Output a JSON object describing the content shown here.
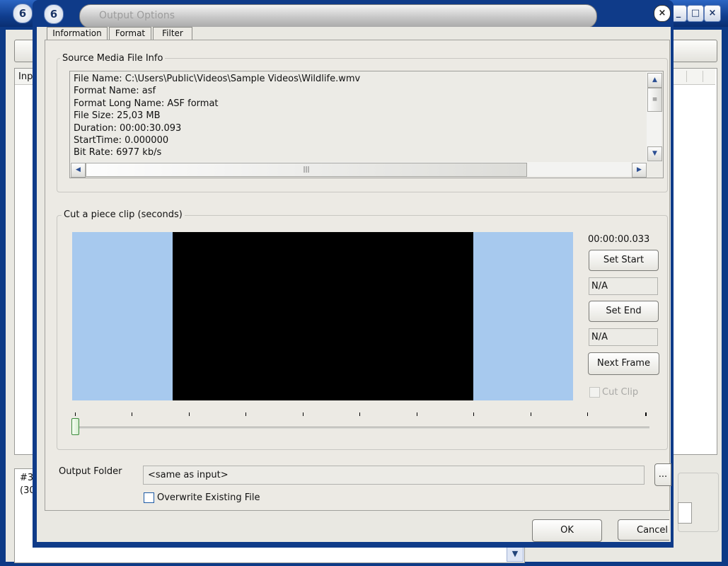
{
  "dialog": {
    "title": "Output Options",
    "close_glyph": "×",
    "tabs": [
      "Information",
      "Format",
      "Filter"
    ]
  },
  "background_window": {
    "list_header": "Inp",
    "log_lines": [
      "#3",
      "(30"
    ]
  },
  "source_info": {
    "group_label": "Source Media File Info",
    "lines": [
      "File Name: C:\\Users\\Public\\Videos\\Sample Videos\\Wildlife.wmv",
      "Format Name: asf",
      "Format Long Name: ASF format",
      "File Size: 25,03 MB",
      "Duration: 00:00:30.093",
      "StartTime: 0.000000",
      "Bit Rate: 6977 kb/s"
    ]
  },
  "clip": {
    "group_label": "Cut a piece clip (seconds)",
    "current_time": "00:00:00.033",
    "set_start_label": "Set Start",
    "start_value": "N/A",
    "set_end_label": "Set End",
    "end_value": "N/A",
    "next_frame_label": "Next Frame",
    "cut_clip_label": "Cut Clip",
    "cut_clip_checked": false,
    "cut_clip_enabled": false,
    "slider_position": 0
  },
  "output": {
    "folder_label": "Output Folder",
    "folder_value": "<same as input>",
    "browse_label": "...",
    "overwrite_label": "Overwrite Existing File",
    "overwrite_checked": false
  },
  "buttons": {
    "ok_label": "OK",
    "cancel_label": "Cancel"
  },
  "colors": {
    "window_frame": "#0f3b89",
    "preview_border": "#a7c9ee",
    "preview_video": "#000000"
  }
}
